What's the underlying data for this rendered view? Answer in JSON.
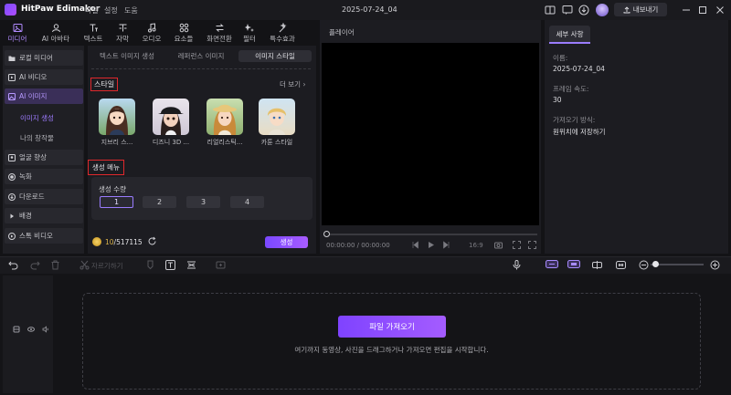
{
  "app": {
    "name": "HitPaw Edimakor",
    "menu": [
      "파일",
      "설정",
      "도움"
    ],
    "project_title": "2025-07-24_04",
    "export_label": "내보내기"
  },
  "toolbar": {
    "tabs": [
      {
        "label": "미디어",
        "icon": "media-icon",
        "active": true
      },
      {
        "label": "AI 아바타",
        "icon": "avatar-icon"
      },
      {
        "label": "텍스트",
        "icon": "text-icon"
      },
      {
        "label": "자막",
        "icon": "subtitle-icon"
      },
      {
        "label": "오디오",
        "icon": "music-icon"
      },
      {
        "label": "요소들",
        "icon": "elements-icon"
      },
      {
        "label": "화면전환",
        "icon": "transition-icon"
      },
      {
        "label": "필터",
        "icon": "filter-icon"
      },
      {
        "label": "특수효과",
        "icon": "effects-icon"
      }
    ]
  },
  "sidebar": {
    "items": [
      {
        "label": "로컬 미디어",
        "icon": "folder-icon"
      },
      {
        "label": "AI 비디오",
        "icon": "ai-video-icon"
      },
      {
        "label": "AI 이미지",
        "icon": "ai-image-icon",
        "active": true
      },
      {
        "label": "얼굴 향상",
        "icon": "face-icon"
      },
      {
        "label": "녹화",
        "icon": "record-icon"
      },
      {
        "label": "다운로드",
        "icon": "download-icon"
      },
      {
        "label": "배경",
        "icon": "background-icon"
      },
      {
        "label": "스톡 비디오",
        "icon": "stock-icon"
      }
    ],
    "sub_items": [
      "이미지 생성",
      "나의 창작물"
    ]
  },
  "media_panel": {
    "subtabs": [
      "텍스트 이미지 생성",
      "레퍼런스 이미지",
      "이미지 스타일"
    ],
    "style_section_title": "스타일",
    "more_label": "더 보기",
    "styles": [
      {
        "label": "지브리 스..."
      },
      {
        "label": "디즈니 3D ..."
      },
      {
        "label": "리얼리스틱..."
      },
      {
        "label": "카툰 스타일"
      }
    ],
    "gen_settings_title": "생성 메뉴",
    "gen_count_label": "생성 수량",
    "counts": [
      "1",
      "2",
      "3",
      "4"
    ],
    "selected_count": "1",
    "credits_used": "10",
    "credits_total": "/517115",
    "generate_label": "생성"
  },
  "player": {
    "title": "플레이어",
    "time": "00:00:00 / 00:00:00",
    "aspect": "16:9"
  },
  "properties": {
    "tab": "세부 사항",
    "fields": [
      {
        "label": "이름:",
        "value": "2025-07-24_04"
      },
      {
        "label": "프레임 속도:",
        "value": "30"
      },
      {
        "label": "가져오기 방식:",
        "value": "원위치에 저장하기"
      }
    ]
  },
  "timeline": {
    "crop_label": "자르기하기",
    "import_label": "파일 가져오기",
    "drop_hint": "여기까지 동영상, 사진을 드래그하거나 가져오면 편집을 시작합니다."
  },
  "colors": {
    "accent": "#9a7cff",
    "highlight_box": "#e0282c",
    "background": "#131316"
  }
}
